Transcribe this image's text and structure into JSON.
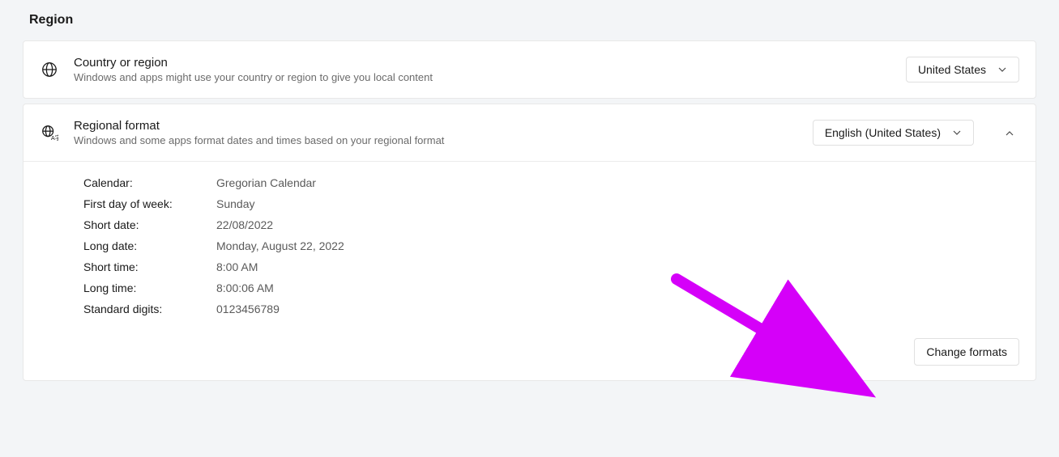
{
  "page": {
    "title": "Region"
  },
  "country": {
    "title": "Country or region",
    "desc": "Windows and apps might use your country or region to give you local content",
    "selected": "United States"
  },
  "regional": {
    "title": "Regional format",
    "desc": "Windows and some apps format dates and times based on your regional format",
    "selected": "English (United States)",
    "details": [
      {
        "label": "Calendar:",
        "value": "Gregorian Calendar"
      },
      {
        "label": "First day of week:",
        "value": "Sunday"
      },
      {
        "label": "Short date:",
        "value": "22/08/2022"
      },
      {
        "label": "Long date:",
        "value": "Monday, August 22, 2022"
      },
      {
        "label": "Short time:",
        "value": "8:00 AM"
      },
      {
        "label": "Long time:",
        "value": "8:00:06 AM"
      },
      {
        "label": "Standard digits:",
        "value": "0123456789"
      }
    ],
    "changeButton": "Change formats"
  }
}
